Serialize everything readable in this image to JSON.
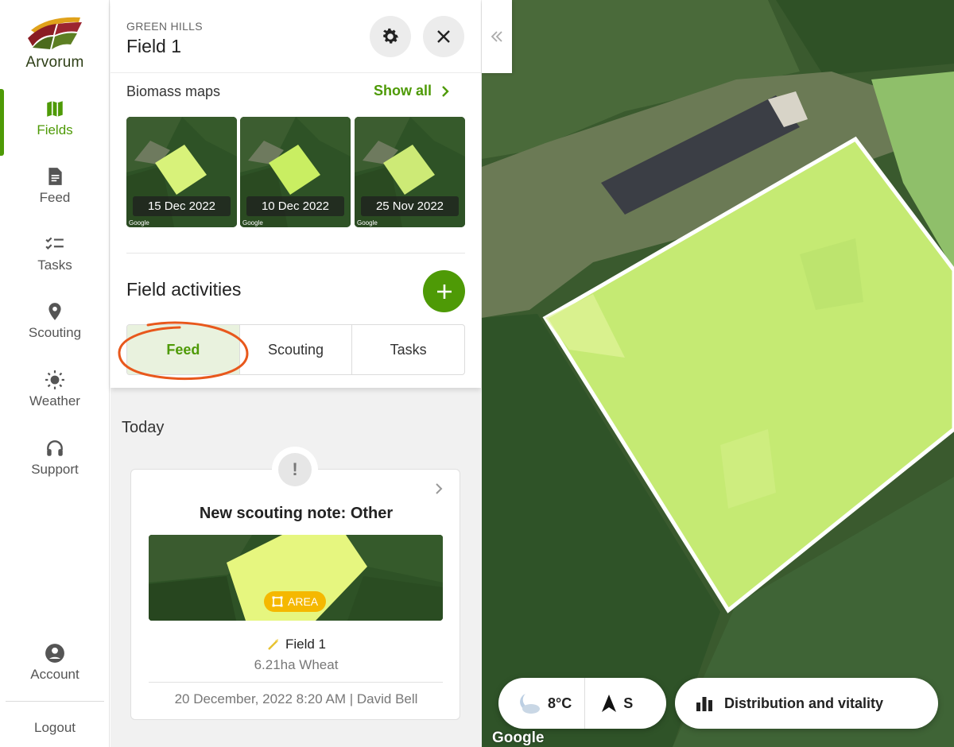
{
  "brand": {
    "name": "Arvorum"
  },
  "nav": {
    "items": [
      {
        "label": "Fields",
        "icon": "map-icon",
        "active": true
      },
      {
        "label": "Feed",
        "icon": "document-icon"
      },
      {
        "label": "Tasks",
        "icon": "checklist-icon"
      },
      {
        "label": "Scouting",
        "icon": "location-pin-icon"
      },
      {
        "label": "Weather",
        "icon": "sun-icon"
      },
      {
        "label": "Support",
        "icon": "headset-icon"
      }
    ],
    "account": "Account",
    "logout": "Logout"
  },
  "field": {
    "farm": "GREEN HILLS",
    "name": "Field 1"
  },
  "biomass": {
    "title": "Biomass maps",
    "show_all": "Show all",
    "maps": [
      {
        "date": "15 Dec 2022",
        "attribution": "Google"
      },
      {
        "date": "10 Dec 2022",
        "attribution": "Google"
      },
      {
        "date": "25 Nov 2022",
        "attribution": "Google"
      }
    ]
  },
  "activities": {
    "title": "Field activities",
    "tabs": [
      "Feed",
      "Scouting",
      "Tasks"
    ],
    "active_tab": "Feed"
  },
  "feed": {
    "group_label": "Today",
    "note": {
      "title": "New scouting note: Other",
      "badge": "AREA",
      "field": "Field 1",
      "crop": "6.21ha Wheat",
      "meta": "20 December, 2022 8:20 AM | David Bell"
    }
  },
  "map": {
    "weather": {
      "temp": "8°C",
      "wind": "S"
    },
    "distribution_label": "Distribution and vitality",
    "attribution": "Google"
  },
  "colors": {
    "accent": "#4e9a06",
    "annotation": "#e8581c",
    "badge": "#f5b800"
  }
}
